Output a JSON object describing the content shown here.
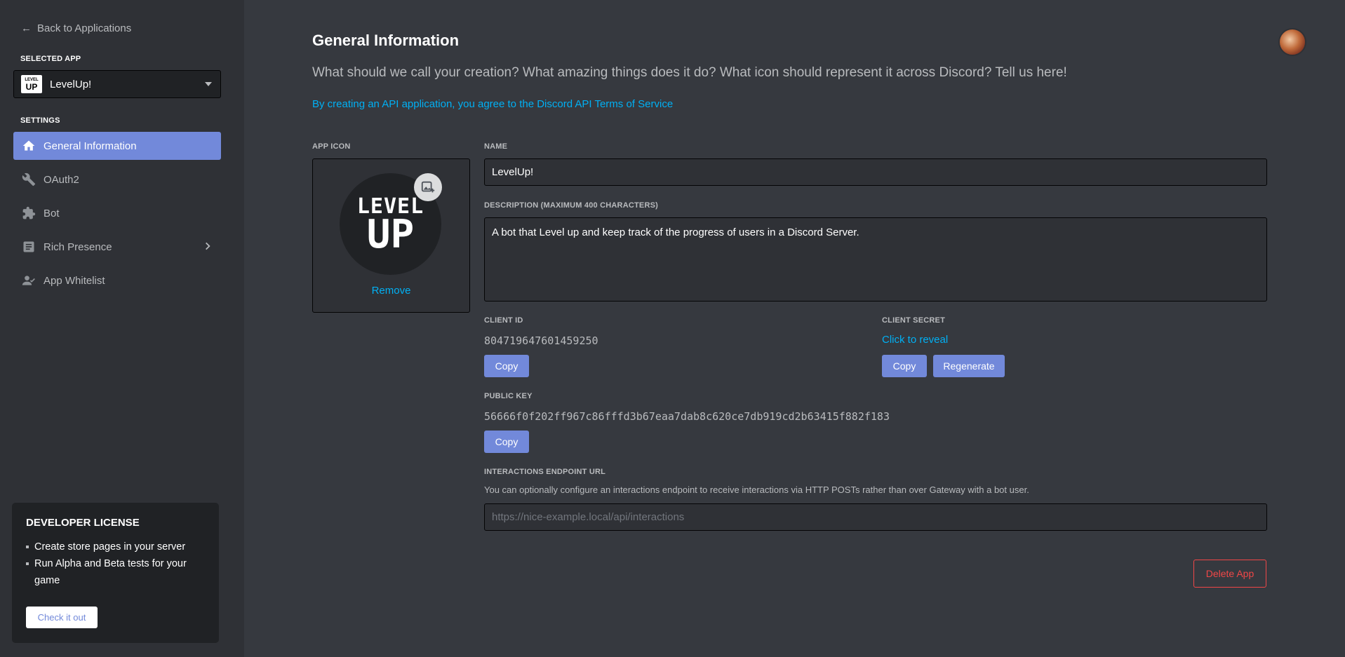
{
  "sidebar": {
    "back_label": "Back to Applications",
    "selected_app_label": "SELECTED APP",
    "selected_app": {
      "name": "LevelUp!",
      "logo_line1": "LEVEL",
      "logo_line2": "UP"
    },
    "settings_label": "SETTINGS",
    "items": [
      {
        "label": "General Information",
        "icon": "home-icon",
        "active": true
      },
      {
        "label": "OAuth2",
        "icon": "wrench-icon"
      },
      {
        "label": "Bot",
        "icon": "puzzle-icon"
      },
      {
        "label": "Rich Presence",
        "icon": "document-icon"
      },
      {
        "label": "App Whitelist",
        "icon": "user-check-icon"
      }
    ],
    "license": {
      "title": "DEVELOPER LICENSE",
      "bullets": [
        "Create store pages in your server",
        "Run Alpha and Beta tests for your game"
      ],
      "button": "Check it out"
    }
  },
  "main": {
    "title": "General Information",
    "subtitle": "What should we call your creation? What amazing things does it do? What icon should represent it across Discord? Tell us here!",
    "tos_link": "By creating an API application, you agree to the Discord API Terms of Service",
    "app_icon": {
      "label": "APP ICON",
      "logo_line1": "LEVEL",
      "logo_line2": "UP",
      "remove": "Remove"
    },
    "name": {
      "label": "NAME",
      "value": "LevelUp!"
    },
    "description": {
      "label": "DESCRIPTION (MAXIMUM 400 CHARACTERS)",
      "value": "A bot that Level up and keep track of the progress of users in a Discord Server."
    },
    "client_id": {
      "label": "CLIENT ID",
      "value": "804719647601459250",
      "copy": "Copy"
    },
    "client_secret": {
      "label": "CLIENT SECRET",
      "reveal": "Click to reveal",
      "copy": "Copy",
      "regenerate": "Regenerate"
    },
    "public_key": {
      "label": "PUBLIC KEY",
      "value": "56666f0f202ff967c86fffd3b67eaa7dab8c620ce7db919cd2b63415f882f183",
      "copy": "Copy"
    },
    "interactions": {
      "label": "INTERACTIONS ENDPOINT URL",
      "hint": "You can optionally configure an interactions endpoint to receive interactions via HTTP POSTs rather than over Gateway with a bot user.",
      "placeholder": "https://nice-example.local/api/interactions"
    },
    "delete": "Delete App"
  },
  "colors": {
    "accent": "#7289da",
    "link": "#00b0f4",
    "danger": "#f04747"
  }
}
